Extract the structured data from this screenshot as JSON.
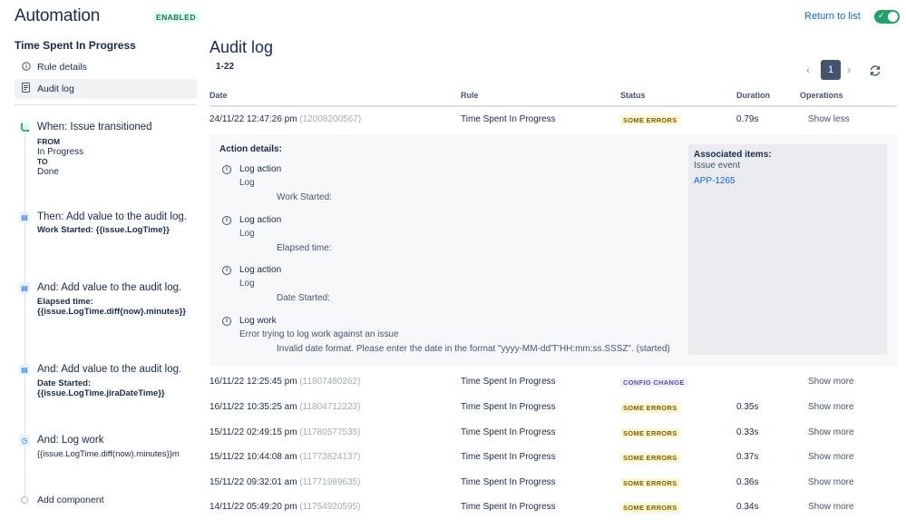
{
  "header": {
    "app_title": "Automation",
    "status_badge": "ENABLED",
    "return_link": "Return to list",
    "toggle_icon": "check-icon"
  },
  "sidebar": {
    "rule_name": "Time Spent In Progress",
    "nav": [
      {
        "label": "Rule details",
        "icon": "info-icon"
      },
      {
        "label": "Audit log",
        "icon": "document-icon"
      }
    ],
    "steps": {
      "trigger": {
        "head": "When: Issue transitioned",
        "from_label": "FROM",
        "from_value": "In Progress",
        "to_label": "TO",
        "to_value": "Done"
      },
      "step1": {
        "head": "Then: Add value to the audit log.",
        "detail": "Work Started: {{issue.LogTime}}"
      },
      "step2": {
        "head": "And: Add value to the audit log.",
        "detail": "Elapsed time: {{issue.LogTime.diff{now}.minutes}}"
      },
      "step3": {
        "head": "And: Add value to the audit log.",
        "detail": "Date Started: {{issue.LogTime.jiraDateTime}}"
      },
      "step4": {
        "head": "And: Log work",
        "detail": "{{issue.LogTime.diff(now).minutes}}m"
      }
    },
    "add_component": "Add component"
  },
  "main": {
    "title": "Audit log",
    "range": "1-22",
    "pager": {
      "page": "1"
    },
    "columns": {
      "date": "Date",
      "rule": "Rule",
      "status": "Status",
      "duration": "Duration",
      "operations": "Operations"
    },
    "expanded_row": {
      "date": "24/11/22 12:47:26 pm",
      "id": "(12008200567)",
      "rule": "Time Spent In Progress",
      "status": "SOME ERRORS",
      "duration": "0.79s",
      "op": "Show less"
    },
    "details": {
      "title": "Action details:",
      "actions": [
        {
          "t1": "Log action",
          "t2": "Log",
          "t3": "Work Started:"
        },
        {
          "t1": "Log action",
          "t2": "Log",
          "t3": "Elapsed time:"
        },
        {
          "t1": "Log action",
          "t2": "Log",
          "t3": "Date Started:"
        },
        {
          "t1": "Log work",
          "t2": "Error trying to log work against an issue",
          "t3": "Invalid date format. Please enter the date in the format \"yyyy-MM-dd'T'HH:mm:ss.SSSZ\". (started)"
        }
      ],
      "associated": {
        "heading": "Associated items:",
        "sub": "Issue event",
        "issue_link": "APP-1265"
      }
    },
    "rows": [
      {
        "date": "16/11/22 12:25:45 pm",
        "id": "(11807480262)",
        "rule": "Time Spent In Progress",
        "status": "CONFIG CHANGE",
        "duration": "",
        "op": "Show more"
      },
      {
        "date": "16/11/22 10:35:25 am",
        "id": "(11804712223)",
        "rule": "Time Spent In Progress",
        "status": "SOME ERRORS",
        "duration": "0.35s",
        "op": "Show more"
      },
      {
        "date": "15/11/22 02:49:15 pm",
        "id": "(11780577535)",
        "rule": "Time Spent In Progress",
        "status": "SOME ERRORS",
        "duration": "0.33s",
        "op": "Show more"
      },
      {
        "date": "15/11/22 10:44:08 am",
        "id": "(11773824137)",
        "rule": "Time Spent In Progress",
        "status": "SOME ERRORS",
        "duration": "0.37s",
        "op": "Show more"
      },
      {
        "date": "15/11/22 09:32:01 am",
        "id": "(11771989635)",
        "rule": "Time Spent In Progress",
        "status": "SOME ERRORS",
        "duration": "0.36s",
        "op": "Show more"
      },
      {
        "date": "14/11/22 05:49:20 pm",
        "id": "(11754920595)",
        "rule": "Time Spent In Progress",
        "status": "SOME ERRORS",
        "duration": "0.34s",
        "op": "Show more"
      }
    ],
    "colors": {
      "accent": "#0c66e4",
      "success": "#22a06b",
      "error_badge_bg": "#fff7d6",
      "config_badge_bg": "#f3f0ff"
    }
  }
}
